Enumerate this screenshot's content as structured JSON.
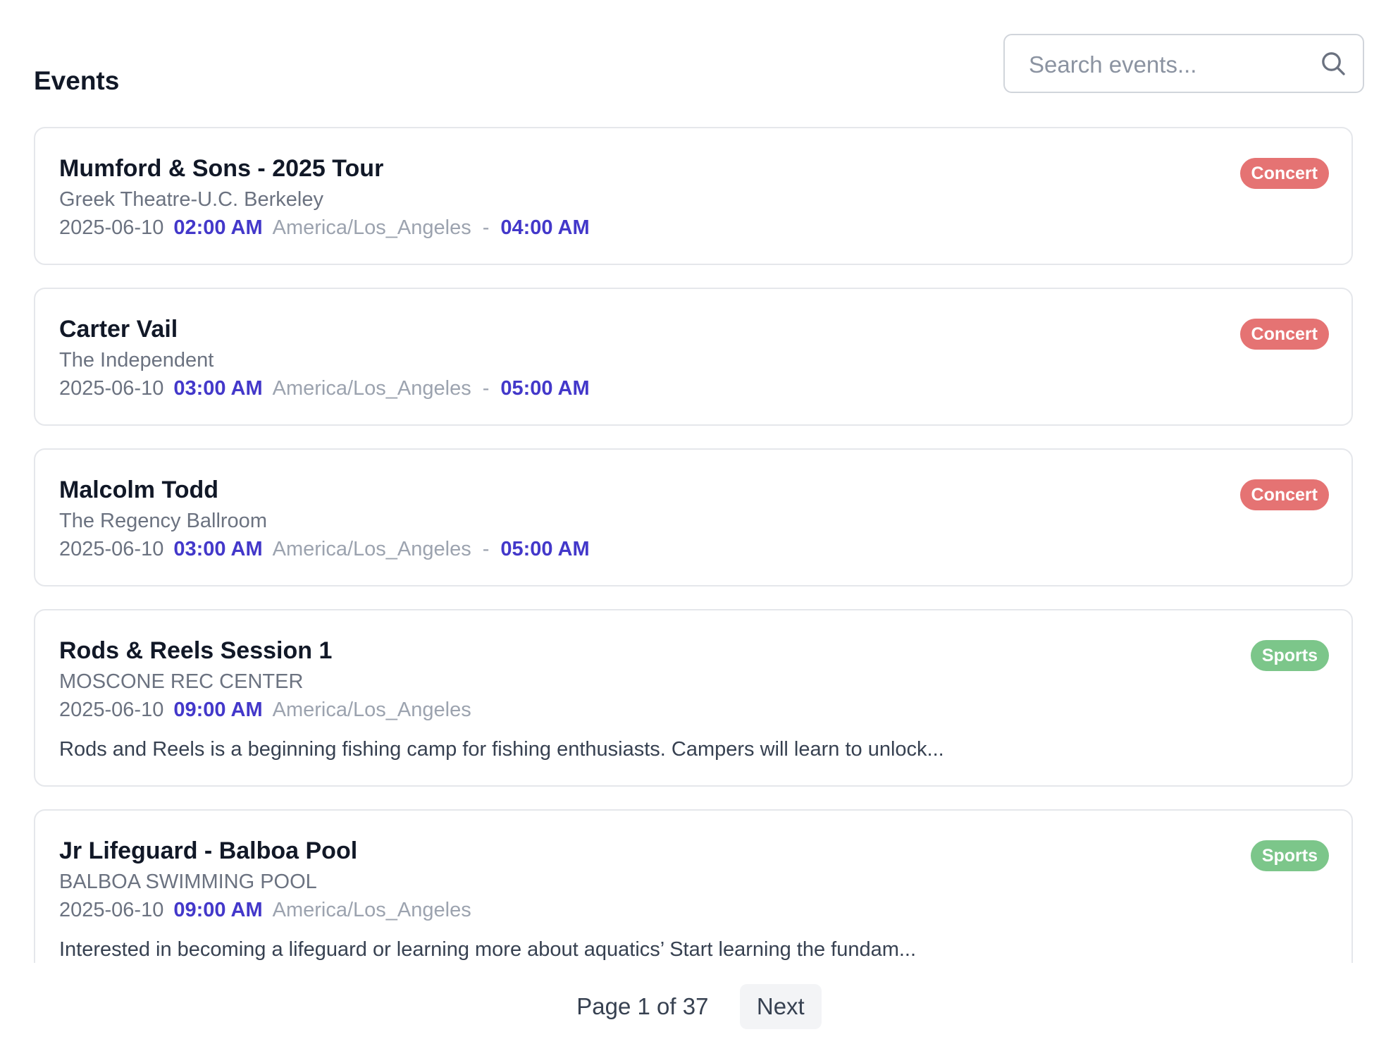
{
  "header": {
    "title": "Events",
    "search_placeholder": "Search events...",
    "search_value": "",
    "search_icon": "search-icon"
  },
  "colors": {
    "concert_badge": "#e57373",
    "sports_badge": "#7cc68a",
    "time_accent": "#4338ca"
  },
  "events": [
    {
      "title": "Mumford & Sons - 2025 Tour",
      "venue": "Greek Theatre-U.C. Berkeley",
      "date": "2025-06-10",
      "start_time": "02:00 AM",
      "timezone": "America/Los_Angeles",
      "separator": "-",
      "end_time": "04:00 AM",
      "description": "",
      "category": "Concert"
    },
    {
      "title": "Carter Vail",
      "venue": "The Independent",
      "date": "2025-06-10",
      "start_time": "03:00 AM",
      "timezone": "America/Los_Angeles",
      "separator": "-",
      "end_time": "05:00 AM",
      "description": "",
      "category": "Concert"
    },
    {
      "title": "Malcolm Todd",
      "venue": "The Regency Ballroom",
      "date": "2025-06-10",
      "start_time": "03:00 AM",
      "timezone": "America/Los_Angeles",
      "separator": "-",
      "end_time": "05:00 AM",
      "description": "",
      "category": "Concert"
    },
    {
      "title": "Rods & Reels Session 1",
      "venue": "MOSCONE REC CENTER",
      "date": "2025-06-10",
      "start_time": "09:00 AM",
      "timezone": "America/Los_Angeles",
      "separator": "",
      "end_time": "",
      "description": "Rods and Reels is a beginning fishing camp for fishing enthusiasts. Campers will learn to unlock...",
      "category": "Sports"
    },
    {
      "title": "Jr Lifeguard - Balboa Pool",
      "venue": "BALBOA SWIMMING POOL",
      "date": "2025-06-10",
      "start_time": "09:00 AM",
      "timezone": "America/Los_Angeles",
      "separator": "",
      "end_time": "",
      "description": "Interested in becoming a lifeguard or learning more about aquatics’ Start learning the fundam...",
      "category": "Sports"
    }
  ],
  "pagination": {
    "page_info": "Page 1 of 37",
    "next_label": "Next"
  }
}
